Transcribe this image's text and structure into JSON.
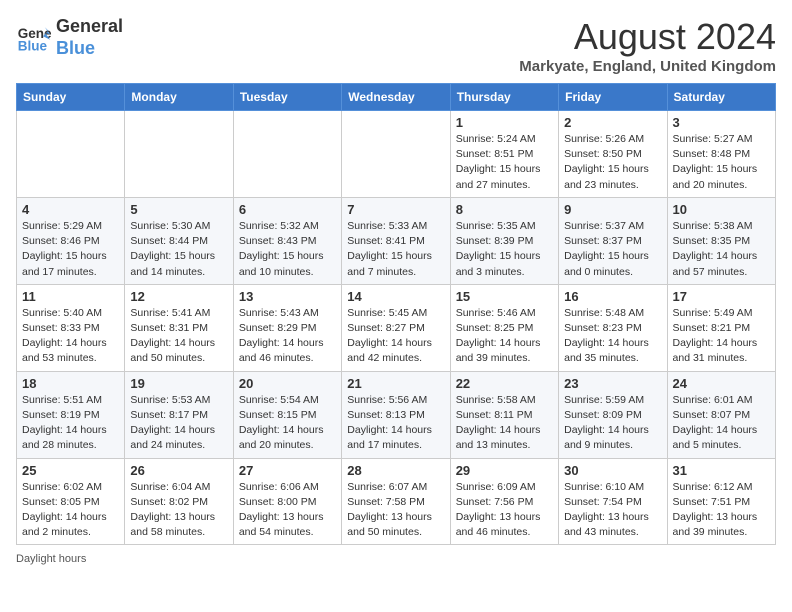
{
  "header": {
    "logo_line1": "General",
    "logo_line2": "Blue",
    "month": "August 2024",
    "location": "Markyate, England, United Kingdom"
  },
  "columns": [
    "Sunday",
    "Monday",
    "Tuesday",
    "Wednesday",
    "Thursday",
    "Friday",
    "Saturday"
  ],
  "weeks": [
    [
      {
        "day": "",
        "detail": ""
      },
      {
        "day": "",
        "detail": ""
      },
      {
        "day": "",
        "detail": ""
      },
      {
        "day": "",
        "detail": ""
      },
      {
        "day": "1",
        "detail": "Sunrise: 5:24 AM\nSunset: 8:51 PM\nDaylight: 15 hours\nand 27 minutes."
      },
      {
        "day": "2",
        "detail": "Sunrise: 5:26 AM\nSunset: 8:50 PM\nDaylight: 15 hours\nand 23 minutes."
      },
      {
        "day": "3",
        "detail": "Sunrise: 5:27 AM\nSunset: 8:48 PM\nDaylight: 15 hours\nand 20 minutes."
      }
    ],
    [
      {
        "day": "4",
        "detail": "Sunrise: 5:29 AM\nSunset: 8:46 PM\nDaylight: 15 hours\nand 17 minutes."
      },
      {
        "day": "5",
        "detail": "Sunrise: 5:30 AM\nSunset: 8:44 PM\nDaylight: 15 hours\nand 14 minutes."
      },
      {
        "day": "6",
        "detail": "Sunrise: 5:32 AM\nSunset: 8:43 PM\nDaylight: 15 hours\nand 10 minutes."
      },
      {
        "day": "7",
        "detail": "Sunrise: 5:33 AM\nSunset: 8:41 PM\nDaylight: 15 hours\nand 7 minutes."
      },
      {
        "day": "8",
        "detail": "Sunrise: 5:35 AM\nSunset: 8:39 PM\nDaylight: 15 hours\nand 3 minutes."
      },
      {
        "day": "9",
        "detail": "Sunrise: 5:37 AM\nSunset: 8:37 PM\nDaylight: 15 hours\nand 0 minutes."
      },
      {
        "day": "10",
        "detail": "Sunrise: 5:38 AM\nSunset: 8:35 PM\nDaylight: 14 hours\nand 57 minutes."
      }
    ],
    [
      {
        "day": "11",
        "detail": "Sunrise: 5:40 AM\nSunset: 8:33 PM\nDaylight: 14 hours\nand 53 minutes."
      },
      {
        "day": "12",
        "detail": "Sunrise: 5:41 AM\nSunset: 8:31 PM\nDaylight: 14 hours\nand 50 minutes."
      },
      {
        "day": "13",
        "detail": "Sunrise: 5:43 AM\nSunset: 8:29 PM\nDaylight: 14 hours\nand 46 minutes."
      },
      {
        "day": "14",
        "detail": "Sunrise: 5:45 AM\nSunset: 8:27 PM\nDaylight: 14 hours\nand 42 minutes."
      },
      {
        "day": "15",
        "detail": "Sunrise: 5:46 AM\nSunset: 8:25 PM\nDaylight: 14 hours\nand 39 minutes."
      },
      {
        "day": "16",
        "detail": "Sunrise: 5:48 AM\nSunset: 8:23 PM\nDaylight: 14 hours\nand 35 minutes."
      },
      {
        "day": "17",
        "detail": "Sunrise: 5:49 AM\nSunset: 8:21 PM\nDaylight: 14 hours\nand 31 minutes."
      }
    ],
    [
      {
        "day": "18",
        "detail": "Sunrise: 5:51 AM\nSunset: 8:19 PM\nDaylight: 14 hours\nand 28 minutes."
      },
      {
        "day": "19",
        "detail": "Sunrise: 5:53 AM\nSunset: 8:17 PM\nDaylight: 14 hours\nand 24 minutes."
      },
      {
        "day": "20",
        "detail": "Sunrise: 5:54 AM\nSunset: 8:15 PM\nDaylight: 14 hours\nand 20 minutes."
      },
      {
        "day": "21",
        "detail": "Sunrise: 5:56 AM\nSunset: 8:13 PM\nDaylight: 14 hours\nand 17 minutes."
      },
      {
        "day": "22",
        "detail": "Sunrise: 5:58 AM\nSunset: 8:11 PM\nDaylight: 14 hours\nand 13 minutes."
      },
      {
        "day": "23",
        "detail": "Sunrise: 5:59 AM\nSunset: 8:09 PM\nDaylight: 14 hours\nand 9 minutes."
      },
      {
        "day": "24",
        "detail": "Sunrise: 6:01 AM\nSunset: 8:07 PM\nDaylight: 14 hours\nand 5 minutes."
      }
    ],
    [
      {
        "day": "25",
        "detail": "Sunrise: 6:02 AM\nSunset: 8:05 PM\nDaylight: 14 hours\nand 2 minutes."
      },
      {
        "day": "26",
        "detail": "Sunrise: 6:04 AM\nSunset: 8:02 PM\nDaylight: 13 hours\nand 58 minutes."
      },
      {
        "day": "27",
        "detail": "Sunrise: 6:06 AM\nSunset: 8:00 PM\nDaylight: 13 hours\nand 54 minutes."
      },
      {
        "day": "28",
        "detail": "Sunrise: 6:07 AM\nSunset: 7:58 PM\nDaylight: 13 hours\nand 50 minutes."
      },
      {
        "day": "29",
        "detail": "Sunrise: 6:09 AM\nSunset: 7:56 PM\nDaylight: 13 hours\nand 46 minutes."
      },
      {
        "day": "30",
        "detail": "Sunrise: 6:10 AM\nSunset: 7:54 PM\nDaylight: 13 hours\nand 43 minutes."
      },
      {
        "day": "31",
        "detail": "Sunrise: 6:12 AM\nSunset: 7:51 PM\nDaylight: 13 hours\nand 39 minutes."
      }
    ]
  ],
  "footer": "Daylight hours"
}
